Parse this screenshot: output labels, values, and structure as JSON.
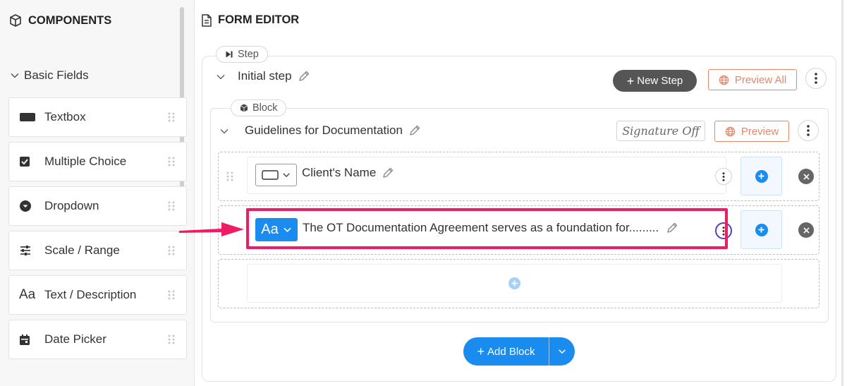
{
  "left_panel": {
    "title": "COMPONENTS",
    "section": "Basic Fields",
    "items": [
      {
        "label": "Textbox",
        "icon": "textbox-icon"
      },
      {
        "label": "Multiple Choice",
        "icon": "checkbox-icon"
      },
      {
        "label": "Dropdown",
        "icon": "dropdown-icon"
      },
      {
        "label": "Scale / Range",
        "icon": "sliders-icon"
      },
      {
        "label": "Text / Description",
        "icon": "text-aa-icon"
      },
      {
        "label": "Date Picker",
        "icon": "calendar-icon"
      }
    ]
  },
  "editor": {
    "title": "FORM EDITOR",
    "step_tag": "Step",
    "step_name": "Initial step",
    "new_step_label": "New Step",
    "preview_all_label": "Preview All",
    "block_tag": "Block",
    "block_name": "Guidelines for Documentation",
    "signature_label": "Signature Off",
    "preview_label": "Preview",
    "fields": [
      {
        "label": "Client's Name",
        "type_icon": "textbox-icon"
      },
      {
        "label": "The OT Documentation Agreement serves as a foundation for.........",
        "type_icon": "text-aa-icon",
        "type_text": "Aa"
      }
    ],
    "add_block_label": "Add Block"
  },
  "colors": {
    "accent": "#1a8cf0",
    "highlight": "#ee1c63",
    "outline_button": "#e5876a",
    "dark_button": "#555555"
  }
}
